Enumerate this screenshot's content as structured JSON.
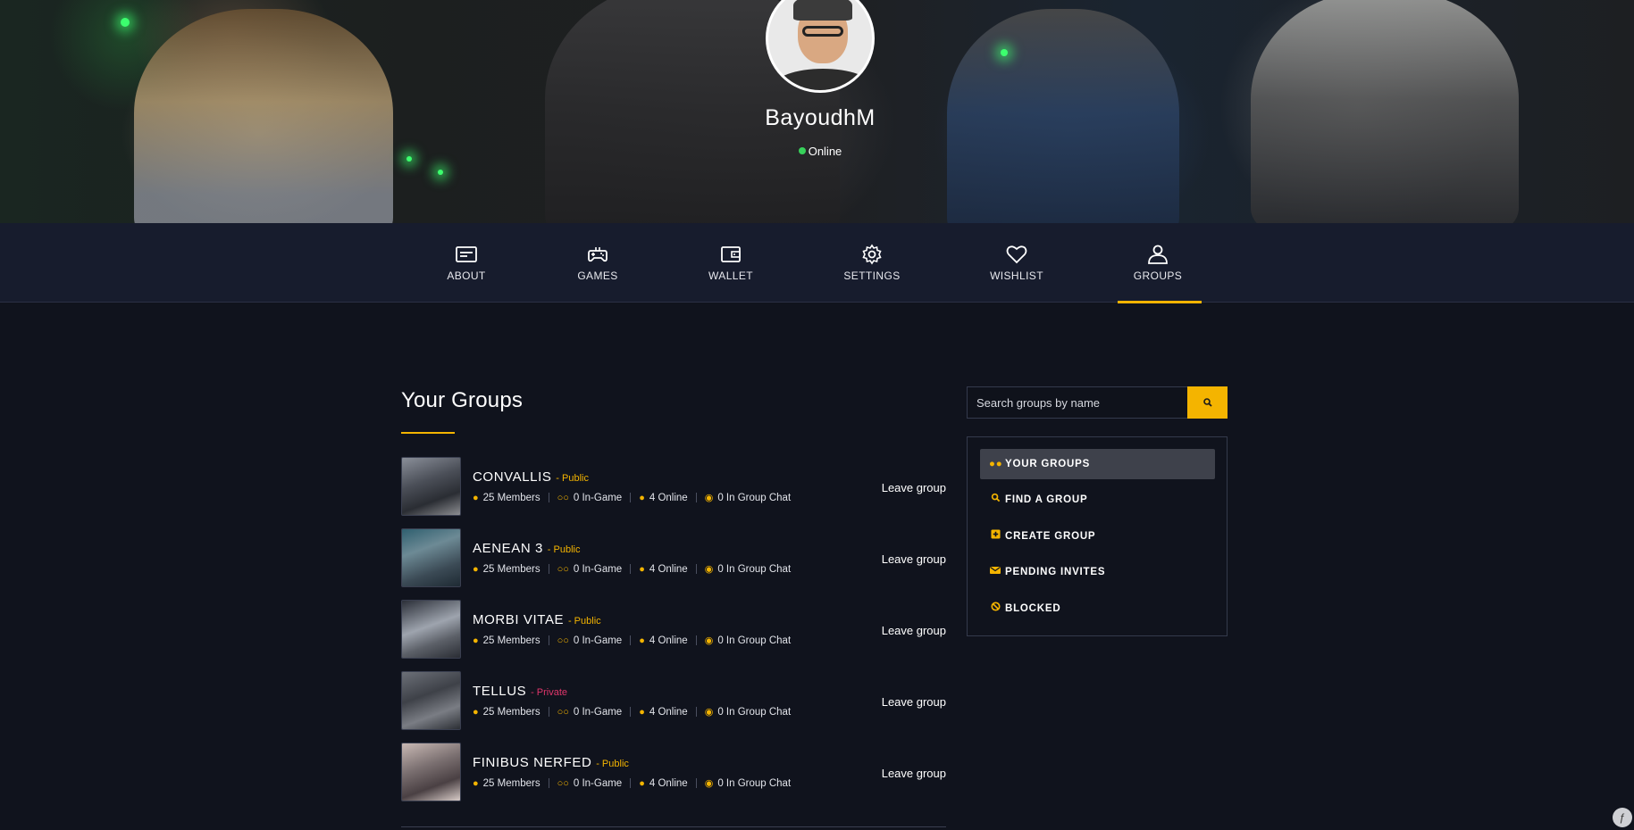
{
  "profile": {
    "username": "BayoudhM",
    "status": "Online"
  },
  "nav": {
    "items": [
      {
        "label": "ABOUT",
        "icon": "id-card-icon"
      },
      {
        "label": "GAMES",
        "icon": "gamepad-icon"
      },
      {
        "label": "WALLET",
        "icon": "wallet-icon"
      },
      {
        "label": "SETTINGS",
        "icon": "gear-icon"
      },
      {
        "label": "WISHLIST",
        "icon": "heart-icon"
      },
      {
        "label": "GROUPS",
        "icon": "user-icon"
      }
    ],
    "active": "GROUPS"
  },
  "main": {
    "title": "Your Groups",
    "leave_label": "Leave group",
    "groups": [
      {
        "name": "CONVALLIS",
        "visibility": "- Public",
        "members": "25 Members",
        "in_game": "0 In-Game",
        "online": "4 Online",
        "chat": "0 In Group Chat"
      },
      {
        "name": "AENEAN 3",
        "visibility": "- Public",
        "members": "25 Members",
        "in_game": "0 In-Game",
        "online": "4 Online",
        "chat": "0 In Group Chat"
      },
      {
        "name": "MORBI VITAE",
        "visibility": "- Public",
        "members": "25 Members",
        "in_game": "0 In-Game",
        "online": "4 Online",
        "chat": "0 In Group Chat"
      },
      {
        "name": "TELLUS",
        "visibility": "- Private",
        "members": "25 Members",
        "in_game": "0 In-Game",
        "online": "4 Online",
        "chat": "0 In Group Chat"
      },
      {
        "name": "FINIBUS NERFED",
        "visibility": "- Public",
        "members": "25 Members",
        "in_game": "0 In-Game",
        "online": "4 Online",
        "chat": "0 In Group Chat"
      }
    ]
  },
  "sidebar": {
    "search_placeholder": "Search groups by name",
    "menu": [
      {
        "label": "YOUR GROUPS",
        "icon": "users-icon"
      },
      {
        "label": "FIND A GROUP",
        "icon": "search-icon"
      },
      {
        "label": "CREATE GROUP",
        "icon": "plus-square-icon"
      },
      {
        "label": "PENDING INVITES",
        "icon": "envelope-icon"
      },
      {
        "label": "BLOCKED",
        "icon": "ban-icon"
      }
    ],
    "active": "YOUR GROUPS"
  },
  "colors": {
    "accent": "#f4b400",
    "background": "#10131d",
    "nav_bg": "#181e30",
    "private": "#e0366b",
    "online_dot": "#37d15a"
  }
}
